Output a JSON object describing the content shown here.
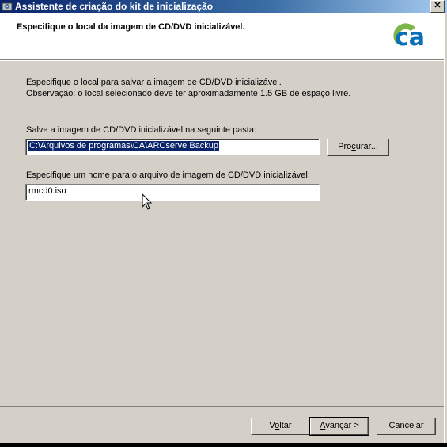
{
  "window": {
    "title": "Assistente de criação do kit de inicialização",
    "close_label": "✕"
  },
  "header": {
    "title": "Especifique o local da imagem de CD/DVD inicializável.",
    "logo_text": "ca"
  },
  "intro": {
    "line1": "Especifique o local para salvar a imagem de CD/DVD inicializável.",
    "line2": "Observação: o local selecionado deve ter aproximadamente 1.5 GB de espaço livre."
  },
  "folder": {
    "label": "Salve a imagem de CD/DVD inicializável na seguinte pasta:",
    "value": "C:\\Arquivos de programas\\CA\\ARCserve Backup",
    "browse_pre": "Pro",
    "browse_u": "c",
    "browse_post": "urar..."
  },
  "filename": {
    "label": "Especifique um nome para o arquivo de imagem de CD/DVD inicializável:",
    "value": "rmcd0.iso"
  },
  "buttons": {
    "back_pre": "V",
    "back_u": "o",
    "back_post": "ltar",
    "next_pre": "",
    "next_u": "A",
    "next_post": "vançar >",
    "cancel": "Cancelar"
  },
  "colors": {
    "title_bar": "#0a246a",
    "dialog_bg": "#d4d0c8",
    "selection": "#0a246a",
    "logo_blue": "#0b6fb8",
    "logo_green": "#7ab648"
  }
}
